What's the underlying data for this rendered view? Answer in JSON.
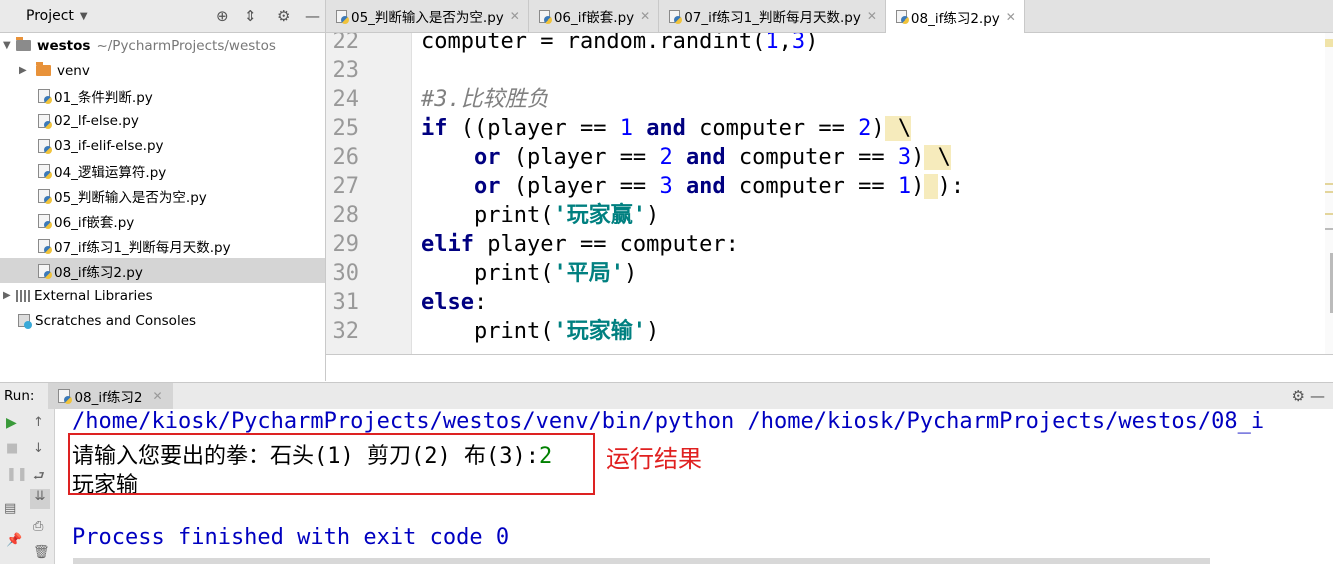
{
  "project": {
    "title": "Project",
    "tree": [
      {
        "name": "westos",
        "extra": "~/PycharmProjects/westos",
        "kind": "root"
      },
      {
        "name": "venv",
        "kind": "folder"
      },
      {
        "name": "01_条件判断.py",
        "kind": "file"
      },
      {
        "name": "02_lf-else.py",
        "kind": "file"
      },
      {
        "name": "03_if-elif-else.py",
        "kind": "file"
      },
      {
        "name": "04_逻辑运算符.py",
        "kind": "file"
      },
      {
        "name": "05_判断输入是否为空.py",
        "kind": "file"
      },
      {
        "name": "06_if嵌套.py",
        "kind": "file"
      },
      {
        "name": "07_if练习1_判断每月天数.py",
        "kind": "file"
      },
      {
        "name": "08_if练习2.py",
        "kind": "file",
        "selected": true
      },
      {
        "name": "External Libraries",
        "kind": "lib"
      },
      {
        "name": "Scratches and Consoles",
        "kind": "scratch"
      }
    ]
  },
  "tabs": [
    {
      "label": "05_判断输入是否为空.py"
    },
    {
      "label": "06_if嵌套.py"
    },
    {
      "label": "07_if练习1_判断每月天数.py"
    },
    {
      "label": "08_if练习2.py",
      "active": true
    }
  ],
  "editor": {
    "line_numbers": [
      "22",
      "23",
      "24",
      "25",
      "26",
      "27",
      "28",
      "29",
      "30",
      "31",
      "32"
    ],
    "code": {
      "l22": {
        "a": "computer = random.randint(",
        "n1": "1",
        ",": ",",
        "n2": "3",
        ")": ")"
      },
      "l24": "#3.比较胜负",
      "l25": {
        "kw": "if",
        "a": " ((player == ",
        "n1": "1",
        "kw2": "and",
        "b": " computer == ",
        "n2": "2",
        ")": ")",
        "w": " \\"
      },
      "l26": {
        "kw": "or",
        "a": " (player == ",
        "n1": "2",
        "kw2": "and",
        "b": " computer == ",
        "n2": "3",
        ")": ")",
        "w": " \\"
      },
      "l27": {
        "kw": "or",
        "a": " (player == ",
        "n1": "3",
        "kw2": "and",
        "b": " computer == ",
        "n2": "1",
        ")": ")",
        "w": " ",
        "end": "):"
      },
      "l28": {
        "a": "print(",
        "s": "'玩家赢'",
        "b": ")"
      },
      "l29": {
        "kw": "elif",
        "a": " player == computer:"
      },
      "l30": {
        "a": "print(",
        "s": "'平局'",
        "b": ")"
      },
      "l31": {
        "kw": "else",
        "a": ":"
      },
      "l32": {
        "a": "print(",
        "s": "'玩家输'",
        "b": ")"
      }
    }
  },
  "run": {
    "label": "Run:",
    "tab": "08_if练习2",
    "console": {
      "command": "/home/kiosk/PycharmProjects/westos/venv/bin/python /home/kiosk/PycharmProjects/westos/08_i",
      "prompt": "请输入您要出的拳：石头(1) 剪刀(2) 布(3):",
      "input": "2",
      "output": "玩家输",
      "finished": "Process finished with exit code 0"
    },
    "annotation": "运行结果"
  }
}
